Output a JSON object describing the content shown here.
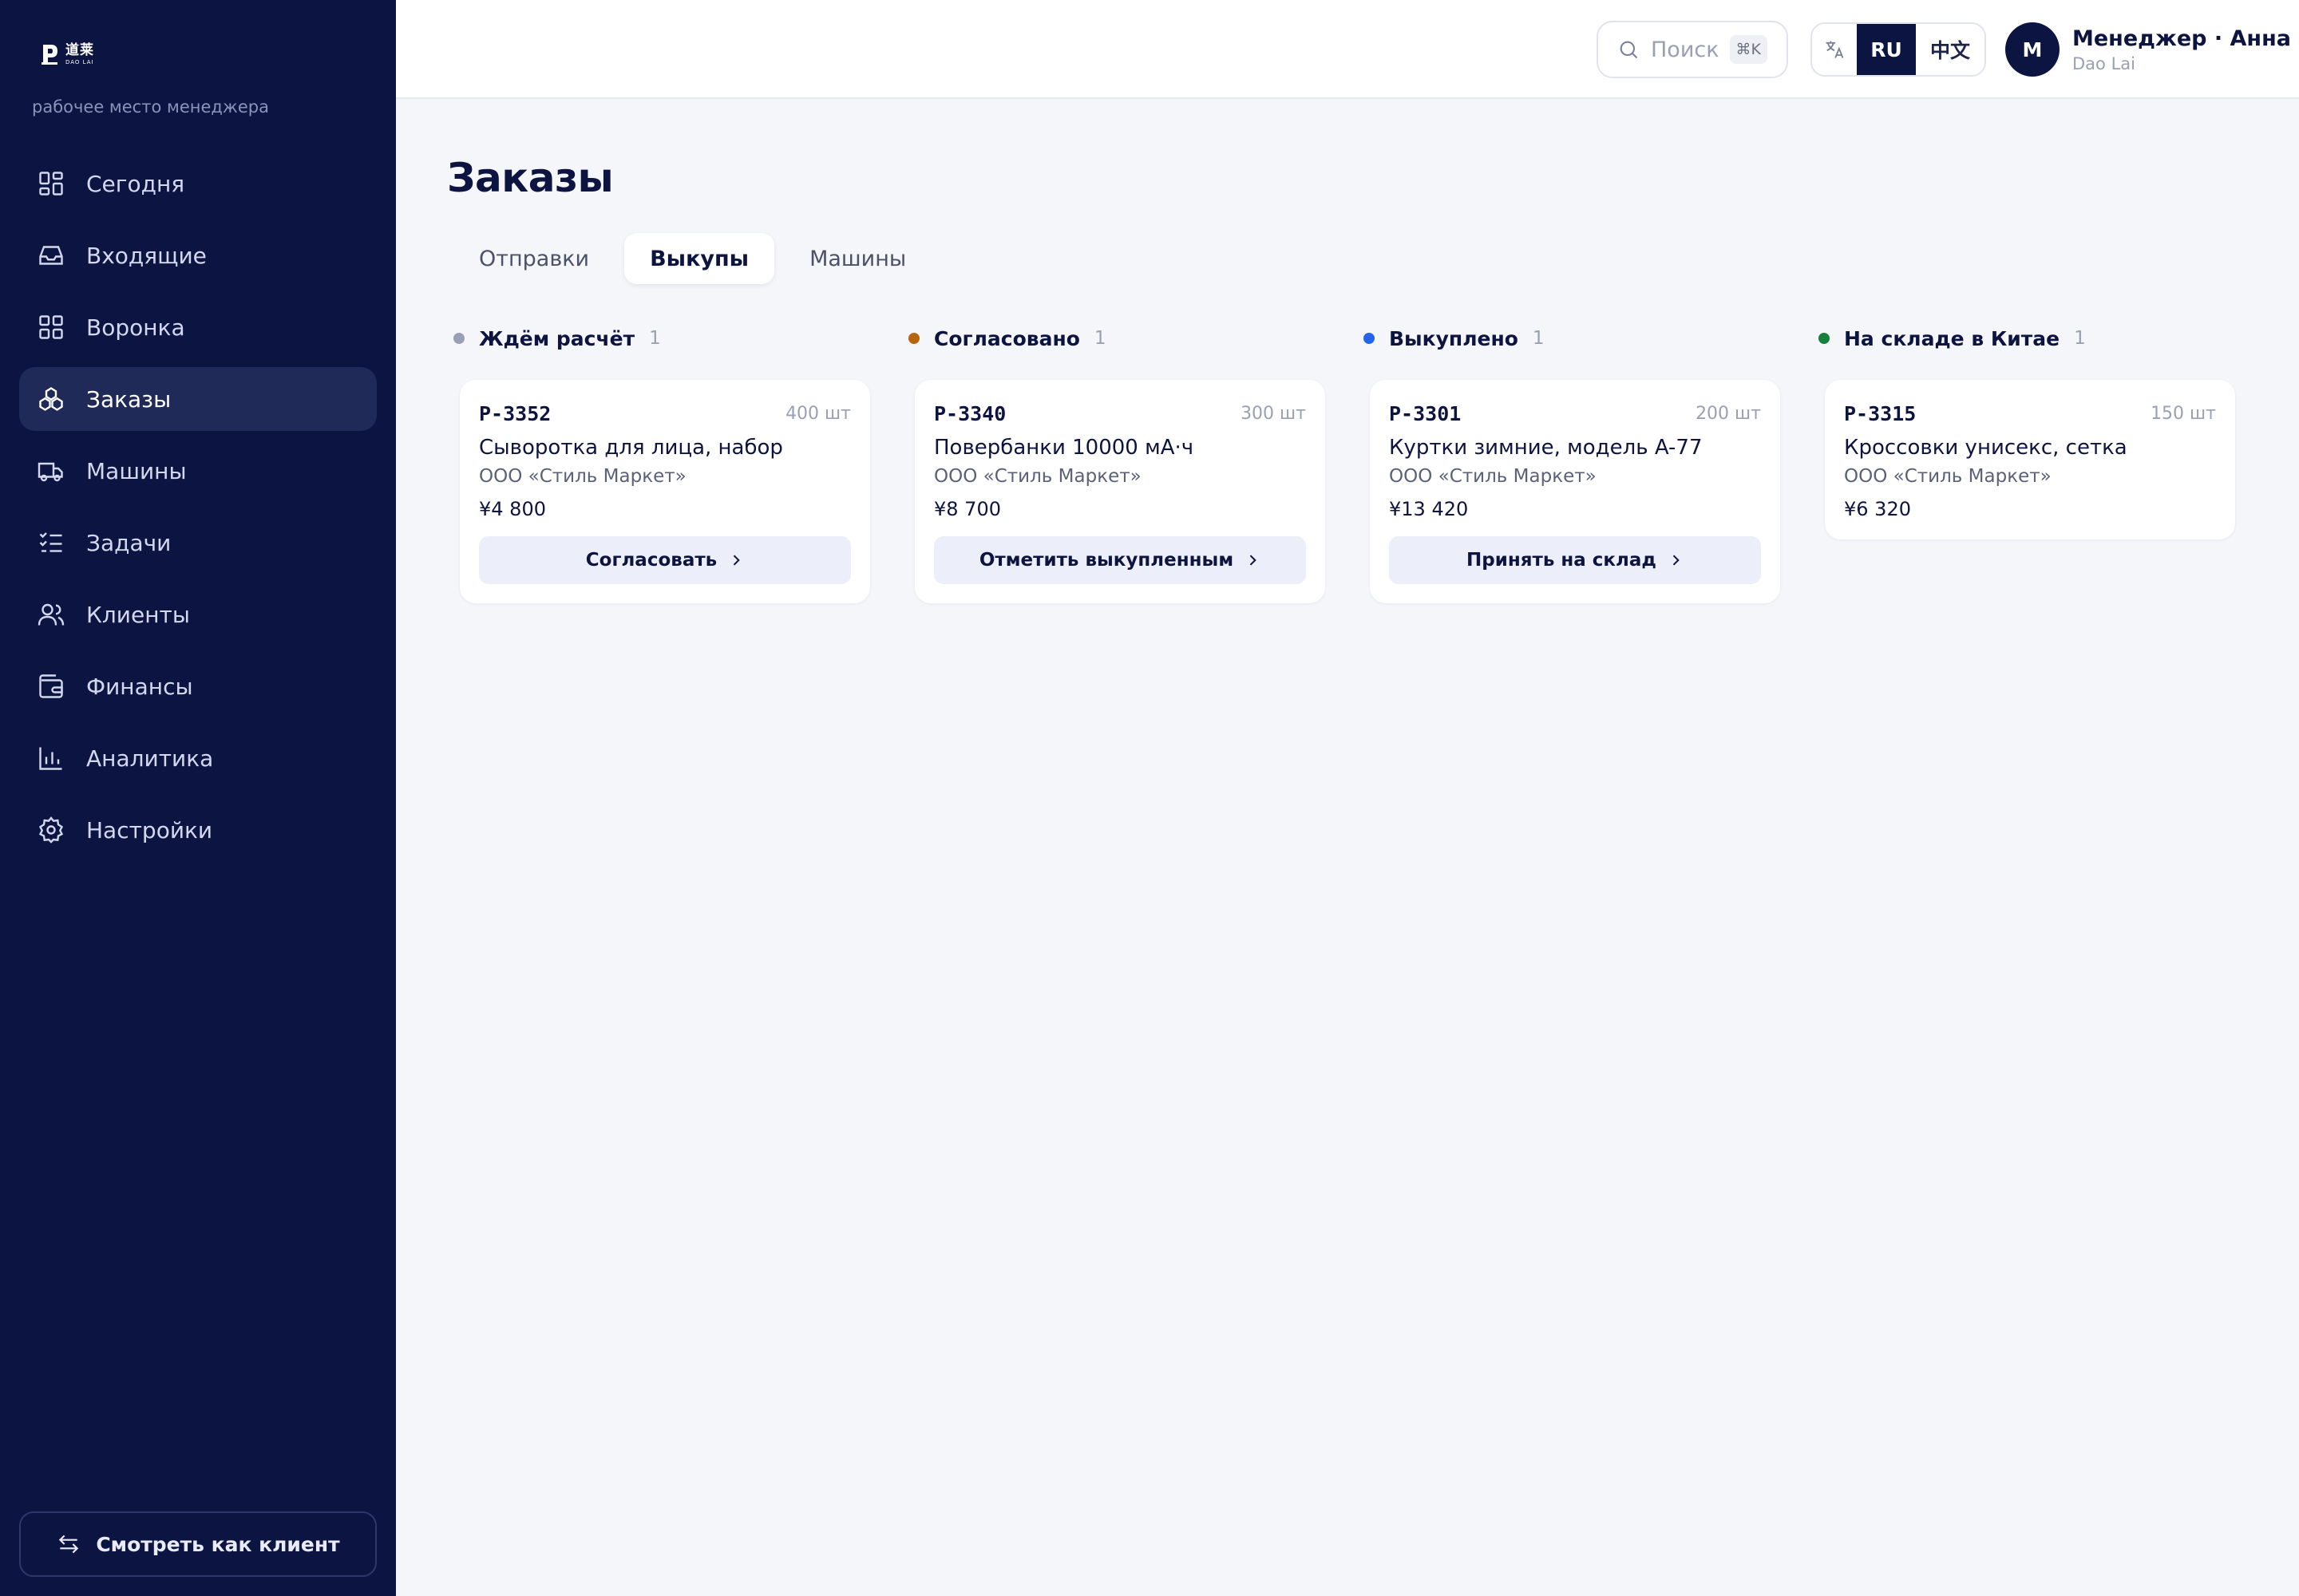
{
  "app": {
    "logo_en": "DAO LAI",
    "logo_cn": "道莱",
    "subtitle": "рабочее место менеджера"
  },
  "sidebar": {
    "items": [
      {
        "label": "Сегодня",
        "icon": "grid-icon",
        "active": false
      },
      {
        "label": "Входящие",
        "icon": "inbox-icon",
        "active": false
      },
      {
        "label": "Воронка",
        "icon": "funnel-grid-icon",
        "active": false
      },
      {
        "label": "Заказы",
        "icon": "boxes-icon",
        "active": true
      },
      {
        "label": "Машины",
        "icon": "truck-icon",
        "active": false
      },
      {
        "label": "Задачи",
        "icon": "checklist-icon",
        "active": false
      },
      {
        "label": "Клиенты",
        "icon": "users-icon",
        "active": false
      },
      {
        "label": "Финансы",
        "icon": "wallet-icon",
        "active": false
      },
      {
        "label": "Аналитика",
        "icon": "bar-chart-icon",
        "active": false
      },
      {
        "label": "Настройки",
        "icon": "gear-icon",
        "active": false
      }
    ],
    "client_view_label": "Смотреть как клиент"
  },
  "header": {
    "search_placeholder": "Поиск",
    "search_shortcut": "⌘K",
    "lang_ru": "RU",
    "lang_cn": "中文",
    "user_initial": "M",
    "user_name": "Менеджер · Анна",
    "user_org": "Dao Lai"
  },
  "main": {
    "title": "Заказы",
    "tabs": [
      {
        "label": "Отправки",
        "active": false
      },
      {
        "label": "Выкупы",
        "active": true
      },
      {
        "label": "Машины",
        "active": false
      }
    ],
    "columns": [
      {
        "title": "Ждём расчёт",
        "count": "1",
        "color": "#9aa0b4",
        "card": {
          "id": "P-3352",
          "qty": "400 шт",
          "name": "Сыворотка для лица, набор",
          "client": "ООО «Стиль Маркет»",
          "price": "¥4 800",
          "action": "Согласовать"
        }
      },
      {
        "title": "Согласовано",
        "count": "1",
        "color": "#b7650b",
        "card": {
          "id": "P-3340",
          "qty": "300 шт",
          "name": "Повербанки 10000 мА·ч",
          "client": "ООО «Стиль Маркет»",
          "price": "¥8 700",
          "action": "Отметить выкупленным"
        }
      },
      {
        "title": "Выкуплено",
        "count": "1",
        "color": "#2563eb",
        "card": {
          "id": "P-3301",
          "qty": "200 шт",
          "name": "Куртки зимние, модель A-77",
          "client": "ООО «Стиль Маркет»",
          "price": "¥13 420",
          "action": "Принять на склад"
        }
      },
      {
        "title": "На складе в Китае",
        "count": "1",
        "color": "#16803c",
        "card": {
          "id": "P-3315",
          "qty": "150 шт",
          "name": "Кроссовки унисекс, сетка",
          "client": "ООО «Стиль Маркет»",
          "price": "¥6 320",
          "action": null
        }
      }
    ]
  }
}
